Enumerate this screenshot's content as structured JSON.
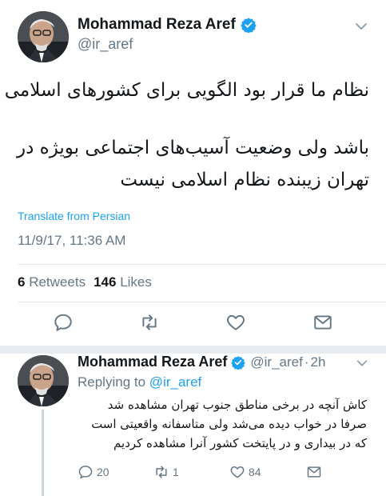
{
  "tweet": {
    "display_name": "Mohammad Reza Aref",
    "handle": "@ir_aref",
    "text_lines": [
      "نظام ما قرار بود الگویی برای کشورهای اسلامی",
      "باشد ولی وضعیت آسیب‌های اجتماعی بویژه در",
      "تهران زیبنده نظام اسلامی نیست"
    ],
    "translate_label": "Translate from Persian",
    "timestamp": "11/9/17, 11:36 AM",
    "retweets_count": "6",
    "retweets_label": "Retweets",
    "likes_count": "146",
    "likes_label": "Likes"
  },
  "reply": {
    "display_name": "Mohammad Reza Aref",
    "handle": "@ir_aref",
    "dot": "·",
    "time": "2h",
    "replying_prefix": "Replying to",
    "replying_handle": "@ir_aref",
    "text_lines": [
      "کاش آنچه در برخی مناطق جنوب تهران مشاهده شد",
      "صرفا در خواب دیده می‌شد ولی متاسفانه واقعیتی است",
      "که در بیداری و در پایتخت کشور آنرا مشاهده کردیم"
    ],
    "reply_count": "20",
    "retweet_count": "1",
    "like_count": "84"
  },
  "colors": {
    "accent": "#1da1f2",
    "muted": "#657786",
    "text": "#14171a",
    "divider": "#e1e8ed"
  },
  "icons": [
    "verified-badge-icon",
    "chevron-down-icon",
    "reply-icon",
    "retweet-icon",
    "heart-icon",
    "message-icon"
  ]
}
